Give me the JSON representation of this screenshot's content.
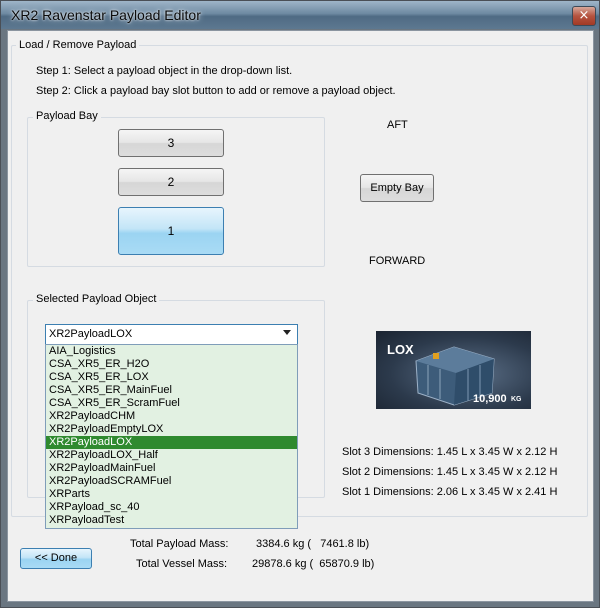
{
  "window": {
    "title": "XR2 Ravenstar Payload Editor",
    "close_glyph": "×"
  },
  "load_group": {
    "label": "Load / Remove Payload",
    "step1": "Step 1: Select a payload object in the drop-down list.",
    "step2": "Step 2: Click a payload bay slot button to add or remove a payload object."
  },
  "payload_bay": {
    "label": "Payload Bay",
    "slots": [
      "3",
      "2",
      "1"
    ],
    "selected_slot": "1"
  },
  "aft_label": "AFT",
  "forward_label": "FORWARD",
  "empty_bay_label": "Empty Bay",
  "selected_payload": {
    "label": "Selected Payload Object",
    "combo_value": "XR2PayloadLOX",
    "options": [
      "AIA_Logistics",
      "CSA_XR5_ER_H2O",
      "CSA_XR5_ER_LOX",
      "CSA_XR5_ER_MainFuel",
      "CSA_XR5_ER_ScramFuel",
      "XR2PayloadCHM",
      "XR2PayloadEmptyLOX",
      "XR2PayloadLOX",
      "XR2PayloadLOX_Half",
      "XR2PayloadMainFuel",
      "XR2PayloadSCRAMFuel",
      "XRParts",
      "XRPayload_sc_40",
      "XRPayloadTest"
    ],
    "selected_option": "XR2PayloadLOX"
  },
  "thumbnail": {
    "title": "LOX",
    "mass_value": "10,900",
    "mass_unit": "KG"
  },
  "dimensions": [
    "Slot 3 Dimensions: 1.45 L x 3.45 W x 2.12 H",
    "Slot 2 Dimensions: 1.45 L x 3.45 W x 2.12 H",
    "Slot 1 Dimensions: 2.06 L x 3.45 W x 2.41 H"
  ],
  "done_label": "<< Done",
  "totals": {
    "payload_label": "Total Payload Mass:",
    "payload_value": "3384.6 kg (   7461.8 lb)",
    "vessel_label": "Total Vessel Mass:",
    "vessel_value": "29878.6 kg (  65870.9 lb)"
  },
  "colors": {
    "selected_slot": "#a9dbf5",
    "dropdown_bg": "#e2f1e2",
    "dropdown_highlight": "#2f8a2f"
  }
}
